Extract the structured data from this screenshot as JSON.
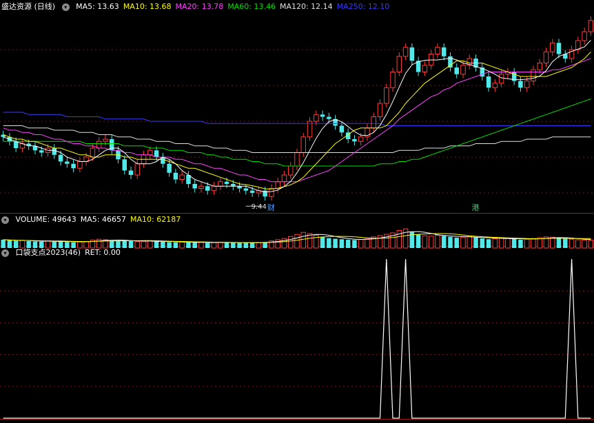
{
  "main_pane": {
    "title": "盛达资源 (日线)",
    "indicators": [
      {
        "label": "MA5: 13.63",
        "color": "#ffffff"
      },
      {
        "label": "MA10: 13.68",
        "color": "#ffff00"
      },
      {
        "label": "MA20: 13.78",
        "color": "#ff40ff"
      },
      {
        "label": "MA60: 13.46",
        "color": "#00e000"
      },
      {
        "label": "MA120: 12.14",
        "color": "#e0e0e0"
      },
      {
        "label": "MA250: 12.10",
        "color": "#3a3aff"
      }
    ],
    "low_marker": "9.44",
    "event_labels": [
      {
        "text": "财",
        "color": "#4aa0ff"
      },
      {
        "text": "港",
        "color": "#30d070"
      }
    ]
  },
  "volume_pane": {
    "indicators": [
      {
        "label": "VOLUME: 49643",
        "color": "#ffffff"
      },
      {
        "label": "MA5: 46657",
        "color": "#ffffff"
      },
      {
        "label": "MA10: 62187",
        "color": "#ffff00"
      }
    ]
  },
  "indicator_pane": {
    "indicators": [
      {
        "label": "口袋支点2023(46)",
        "color": "#ffffff"
      },
      {
        "label": "RET: 0.00",
        "color": "#ffffff"
      }
    ]
  },
  "chart_data": [
    {
      "type": "candlestick",
      "title": "盛达资源 (日线)",
      "ylim": [
        8.8,
        17.6
      ],
      "close": [
        12.1,
        11.9,
        11.6,
        11.8,
        11.7,
        11.5,
        11.4,
        11.6,
        11.3,
        11.0,
        10.9,
        10.7,
        11.0,
        11.2,
        11.6,
        11.9,
        12.0,
        11.5,
        11.1,
        10.6,
        10.4,
        10.9,
        11.3,
        11.5,
        11.2,
        10.9,
        10.5,
        10.2,
        10.4,
        10.0,
        9.8,
        9.9,
        9.7,
        9.9,
        10.1,
        10.0,
        9.9,
        9.8,
        9.7,
        9.6,
        9.7,
        9.44,
        9.8,
        10.1,
        10.4,
        10.8,
        11.4,
        12.1,
        12.8,
        13.1,
        13.0,
        12.9,
        12.6,
        12.3,
        12.0,
        11.9,
        12.1,
        12.5,
        13.0,
        13.6,
        14.3,
        15.0,
        15.7,
        16.1,
        15.5,
        15.0,
        15.3,
        15.8,
        16.1,
        15.7,
        15.2,
        14.9,
        15.3,
        15.6,
        15.2,
        14.8,
        14.3,
        14.5,
        14.9,
        15.0,
        14.6,
        14.3,
        14.6,
        15.1,
        15.4,
        15.9,
        16.3,
        15.8,
        15.6,
        16.0,
        16.4,
        16.8,
        17.3
      ],
      "ma5": [
        12.1,
        12.0,
        11.9,
        11.8,
        11.7,
        11.7,
        11.6,
        11.5,
        11.5,
        11.4,
        11.2,
        11.1,
        11.0,
        11.0,
        11.1,
        11.3,
        11.5,
        11.6,
        11.6,
        11.4,
        11.1,
        10.9,
        10.9,
        10.9,
        11.0,
        11.2,
        11.1,
        10.9,
        10.6,
        10.4,
        10.2,
        10.1,
        10.0,
        9.9,
        9.9,
        9.9,
        9.9,
        9.9,
        9.9,
        9.8,
        9.7,
        9.65,
        9.66,
        9.73,
        9.89,
        10.11,
        10.5,
        10.96,
        11.5,
        12.04,
        12.48,
        12.78,
        12.88,
        12.78,
        12.56,
        12.34,
        12.18,
        12.16,
        12.3,
        12.62,
        13.1,
        13.68,
        14.32,
        14.94,
        15.32,
        15.46,
        15.52,
        15.54,
        15.54,
        15.58,
        15.62,
        15.54,
        15.4,
        15.34,
        15.24,
        15.16,
        15.04,
        14.9,
        14.74,
        14.7,
        14.66,
        14.66,
        14.68,
        14.72,
        14.82,
        15.06,
        15.46,
        15.7,
        15.8,
        15.92,
        16.02,
        16.12,
        16.42
      ],
      "ma10": [
        12.2,
        12.1,
        12.0,
        12.0,
        11.9,
        11.9,
        11.8,
        11.7,
        11.6,
        11.6,
        11.5,
        11.4,
        11.3,
        11.3,
        11.2,
        11.2,
        11.3,
        11.3,
        11.3,
        11.2,
        11.2,
        11.1,
        11.1,
        11.1,
        11.1,
        11.1,
        11.0,
        10.9,
        10.8,
        10.7,
        10.7,
        10.6,
        10.5,
        10.4,
        10.3,
        10.2,
        10.1,
        10.0,
        9.97,
        9.92,
        9.86,
        9.78,
        9.78,
        9.81,
        9.88,
        9.96,
        10.1,
        10.3,
        10.6,
        10.9,
        11.2,
        11.5,
        11.8,
        12.0,
        12.2,
        12.4,
        12.5,
        12.5,
        12.5,
        12.5,
        12.6,
        12.9,
        13.2,
        13.6,
        13.9,
        14.2,
        14.5,
        14.7,
        14.9,
        15.1,
        15.3,
        15.5,
        15.5,
        15.4,
        15.4,
        15.4,
        15.3,
        15.2,
        15.1,
        15.0,
        14.9,
        14.8,
        14.8,
        14.8,
        14.8,
        14.8,
        14.9,
        15.0,
        15.1,
        15.2,
        15.4,
        15.6,
        15.9
      ],
      "ma20": [
        12.5,
        12.4,
        12.4,
        12.3,
        12.3,
        12.2,
        12.2,
        12.1,
        12.0,
        12.0,
        11.9,
        11.8,
        11.8,
        11.7,
        11.7,
        11.6,
        11.6,
        11.5,
        11.5,
        11.4,
        11.4,
        11.3,
        11.3,
        11.3,
        11.2,
        11.2,
        11.2,
        11.1,
        11.1,
        11.0,
        10.9,
        10.9,
        10.8,
        10.7,
        10.7,
        10.6,
        10.5,
        10.4,
        10.4,
        10.3,
        10.2,
        10.2,
        10.1,
        10.1,
        10.1,
        10.1,
        10.1,
        10.2,
        10.3,
        10.4,
        10.5,
        10.6,
        10.8,
        11.0,
        11.2,
        11.4,
        11.6,
        11.8,
        12.0,
        12.2,
        12.4,
        12.6,
        12.9,
        13.1,
        13.3,
        13.5,
        13.7,
        13.9,
        14.0,
        14.2,
        14.3,
        14.5,
        14.6,
        14.7,
        14.8,
        14.9,
        15.0,
        15.0,
        15.0,
        15.0,
        15.0,
        15.0,
        15.0,
        15.0,
        15.0,
        15.0,
        15.1,
        15.1,
        15.2,
        15.3,
        15.4,
        15.5,
        15.6
      ],
      "ma60": [
        11.9,
        11.9,
        11.9,
        11.9,
        11.9,
        11.9,
        11.9,
        11.9,
        11.9,
        11.9,
        11.9,
        11.9,
        11.9,
        11.8,
        11.8,
        11.8,
        11.8,
        11.8,
        11.8,
        11.7,
        11.7,
        11.7,
        11.7,
        11.6,
        11.6,
        11.6,
        11.5,
        11.5,
        11.5,
        11.4,
        11.4,
        11.4,
        11.3,
        11.3,
        11.2,
        11.2,
        11.1,
        11.1,
        11.1,
        11.0,
        11.0,
        10.9,
        10.9,
        10.9,
        10.8,
        10.8,
        10.8,
        10.8,
        10.8,
        10.8,
        10.8,
        10.8,
        10.8,
        10.8,
        10.8,
        10.8,
        10.8,
        10.8,
        10.8,
        10.9,
        10.9,
        10.9,
        11.0,
        11.0,
        11.1,
        11.1,
        11.2,
        11.3,
        11.4,
        11.5,
        11.6,
        11.7,
        11.8,
        11.9,
        12.0,
        12.1,
        12.2,
        12.3,
        12.4,
        12.5,
        12.6,
        12.7,
        12.8,
        12.9,
        13.0,
        13.1,
        13.2,
        13.3,
        13.4,
        13.5,
        13.6,
        13.7,
        13.8
      ],
      "ma120": [
        12.6,
        12.6,
        12.6,
        12.6,
        12.5,
        12.5,
        12.5,
        12.5,
        12.4,
        12.4,
        12.4,
        12.4,
        12.3,
        12.3,
        12.3,
        12.2,
        12.2,
        12.2,
        12.1,
        12.1,
        12.1,
        12.0,
        12.0,
        12.0,
        11.9,
        11.9,
        11.9,
        11.8,
        11.8,
        11.8,
        11.7,
        11.7,
        11.7,
        11.6,
        11.6,
        11.6,
        11.5,
        11.5,
        11.5,
        11.4,
        11.4,
        11.4,
        11.4,
        11.4,
        11.4,
        11.4,
        11.4,
        11.4,
        11.4,
        11.4,
        11.4,
        11.4,
        11.4,
        11.4,
        11.4,
        11.4,
        11.4,
        11.4,
        11.4,
        11.4,
        11.4,
        11.4,
        11.5,
        11.5,
        11.5,
        11.5,
        11.6,
        11.6,
        11.6,
        11.6,
        11.7,
        11.7,
        11.7,
        11.7,
        11.8,
        11.8,
        11.8,
        11.8,
        11.9,
        11.9,
        11.9,
        11.9,
        12.0,
        12.0,
        12.0,
        12.0,
        12.1,
        12.1,
        12.1,
        12.1,
        12.1,
        12.1,
        12.1
      ],
      "ma250": [
        13.2,
        13.2,
        13.2,
        13.2,
        13.1,
        13.1,
        13.1,
        13.1,
        13.1,
        13.1,
        13.0,
        13.0,
        13.0,
        13.0,
        13.0,
        13.0,
        12.9,
        12.9,
        12.9,
        12.9,
        12.9,
        12.9,
        12.9,
        12.8,
        12.8,
        12.8,
        12.8,
        12.8,
        12.8,
        12.8,
        12.8,
        12.8,
        12.7,
        12.7,
        12.7,
        12.7,
        12.7,
        12.7,
        12.7,
        12.7,
        12.7,
        12.7,
        12.7,
        12.7,
        12.7,
        12.7,
        12.7,
        12.7,
        12.7,
        12.7,
        12.7,
        12.7,
        12.7,
        12.7,
        12.7,
        12.7,
        12.7,
        12.7,
        12.7,
        12.7,
        12.6,
        12.6,
        12.6,
        12.6,
        12.6,
        12.6,
        12.6,
        12.6,
        12.6,
        12.6,
        12.6,
        12.6,
        12.6,
        12.6,
        12.6,
        12.6,
        12.6,
        12.6,
        12.6,
        12.6,
        12.6,
        12.6,
        12.6,
        12.6,
        12.6,
        12.6,
        12.6,
        12.6,
        12.6,
        12.6,
        12.6,
        12.6,
        12.6
      ]
    },
    {
      "type": "bar",
      "title": "VOLUME",
      "values": [
        52000,
        48000,
        45000,
        47000,
        43000,
        41000,
        40000,
        44000,
        39000,
        42000,
        38000,
        36000,
        40000,
        41000,
        50000,
        55000,
        52000,
        46000,
        44000,
        48000,
        43000,
        40000,
        42000,
        45000,
        41000,
        39000,
        37000,
        36000,
        38000,
        35000,
        34000,
        36000,
        33000,
        35000,
        37000,
        34000,
        33000,
        32000,
        34000,
        33000,
        35000,
        38000,
        45000,
        52000,
        60000,
        72000,
        85000,
        98000,
        90000,
        80000,
        70000,
        62000,
        58000,
        55000,
        52000,
        50000,
        54000,
        60000,
        70000,
        78000,
        86000,
        95000,
        110000,
        120000,
        100000,
        85000,
        78000,
        74000,
        80000,
        76000,
        70000,
        65000,
        68000,
        72000,
        66000,
        60000,
        55000,
        58000,
        62000,
        60000,
        56000,
        52000,
        55000,
        60000,
        65000,
        70000,
        68000,
        62000,
        58000,
        55000,
        52000,
        50000,
        49643
      ]
    },
    {
      "type": "line",
      "title": "口袋支点2023(46)",
      "ylim": [
        0,
        1
      ],
      "spikes_at": [
        60,
        63,
        89
      ],
      "values_note_unused": ""
    }
  ]
}
